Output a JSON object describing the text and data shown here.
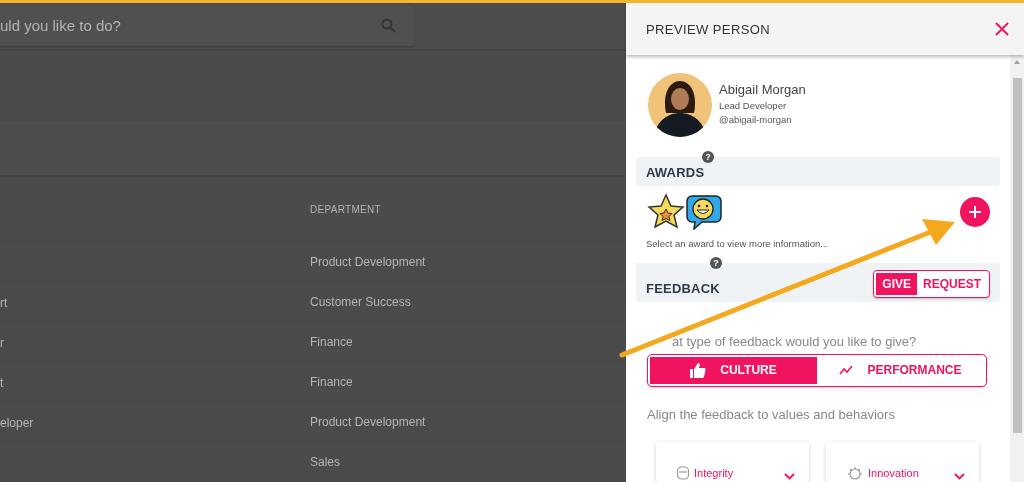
{
  "background": {
    "search": {
      "placeholder": "uld you like to do?"
    },
    "table": {
      "columns": [
        "DEPARTMENT"
      ],
      "rows": [
        {
          "department": "Product Development"
        },
        {
          "column_1": "rt",
          "department": "Customer Success"
        },
        {
          "column_1": "r",
          "department": "Finance"
        },
        {
          "column_1": "t",
          "department": "Finance"
        },
        {
          "column_1": "eloper",
          "department": "Product Development"
        },
        {
          "department": "Sales"
        }
      ]
    }
  },
  "panel": {
    "title": "PREVIEW PERSON",
    "person": {
      "name": "Abigail Morgan",
      "role": "Lead Developer",
      "handle": "@abigail-morgan"
    },
    "awards": {
      "heading": "AWARDS",
      "help": "?",
      "items": [
        {
          "kind": "star"
        },
        {
          "kind": "bubble"
        }
      ],
      "hint": "Select an award to view more information..."
    },
    "feedback": {
      "heading": "FEEDBACK",
      "help": "?",
      "modes": [
        {
          "label": "GIVE",
          "selected": true
        },
        {
          "label": "REQUEST",
          "selected": false
        }
      ],
      "question": "at type of feedback would you like to give?",
      "types": [
        {
          "label": "CULTURE",
          "kind": "thumb",
          "selected": true
        },
        {
          "label": "PERFORMANCE",
          "kind": "trend",
          "selected": false
        }
      ],
      "prompt": "Align the feedback to values and behaviors",
      "values": [
        {
          "label": "Integrity",
          "kind": "face"
        },
        {
          "label": "Innovation",
          "kind": "gear"
        }
      ]
    }
  },
  "annotation": {
    "kind": "arrow"
  }
}
